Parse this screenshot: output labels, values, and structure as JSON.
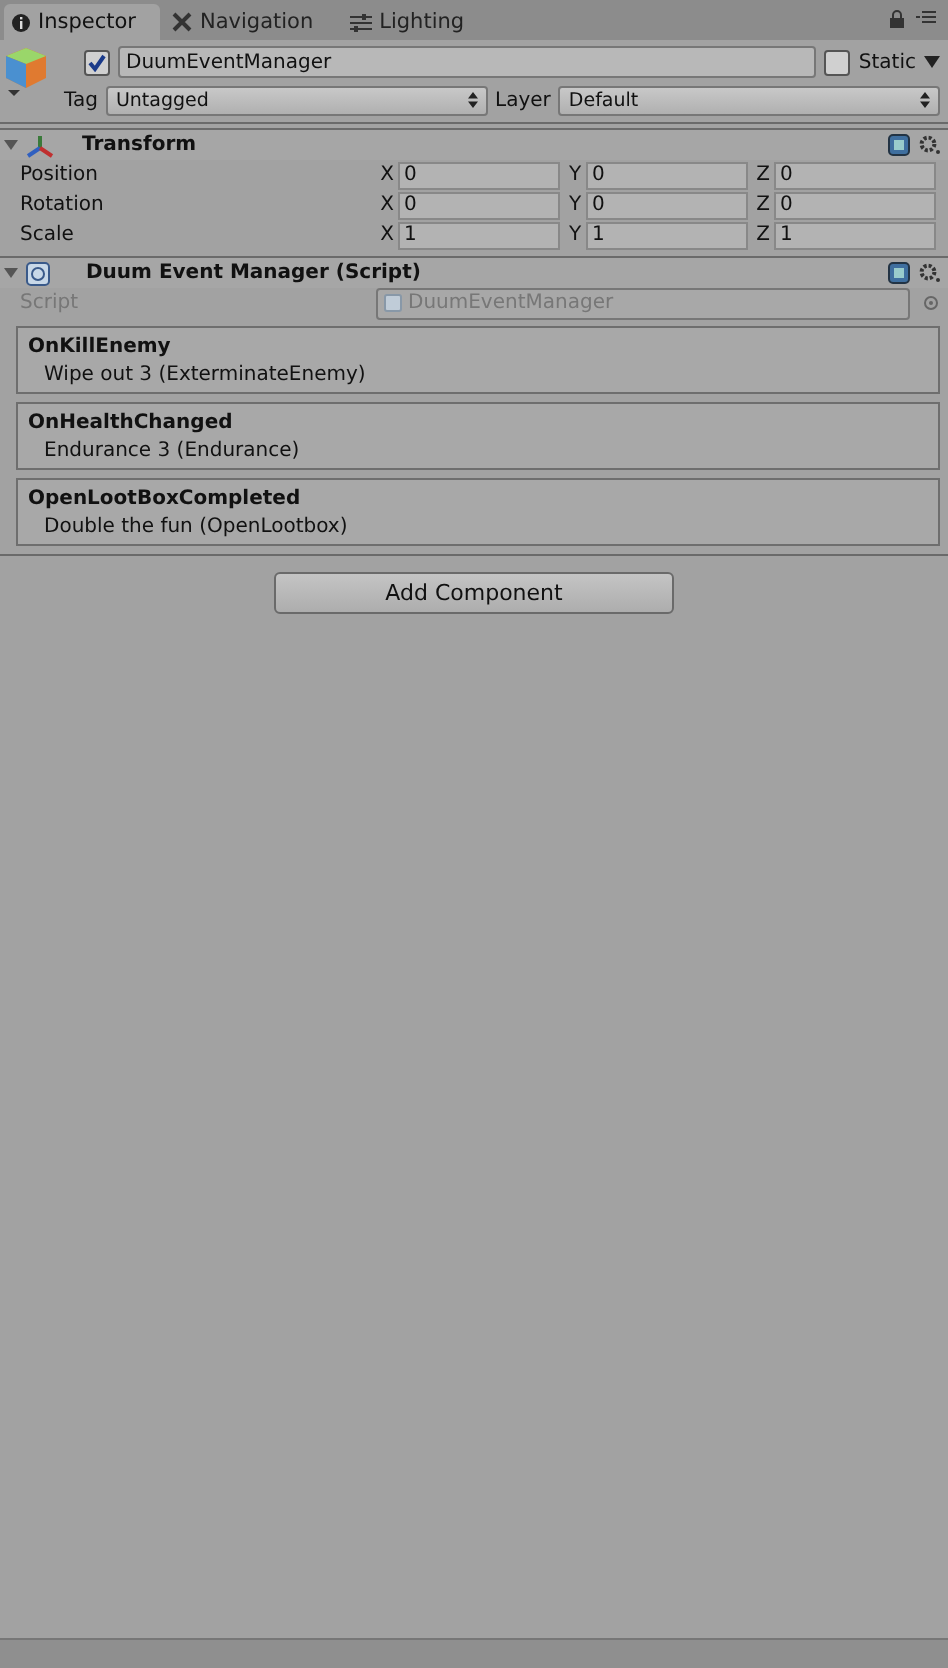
{
  "tabs": [
    {
      "label": "Inspector",
      "kind": "info",
      "selected": true
    },
    {
      "label": "Navigation",
      "kind": "nav",
      "selected": false
    },
    {
      "label": "Lighting",
      "kind": "light",
      "selected": false
    }
  ],
  "game_object": {
    "active": true,
    "name": "DuumEventManager",
    "static": false,
    "static_label": "Static",
    "tag_label": "Tag",
    "tag": "Untagged",
    "layer_label": "Layer",
    "layer": "Default"
  },
  "transform": {
    "title": "Transform",
    "expanded": true,
    "rows": [
      {
        "label": "Position",
        "fields": [
          {
            "axis": "X",
            "value": "0"
          },
          {
            "axis": "Y",
            "value": "0"
          },
          {
            "axis": "Z",
            "value": "0"
          }
        ]
      },
      {
        "label": "Rotation",
        "fields": [
          {
            "axis": "X",
            "value": "0"
          },
          {
            "axis": "Y",
            "value": "0"
          },
          {
            "axis": "Z",
            "value": "0"
          }
        ]
      },
      {
        "label": "Scale",
        "fields": [
          {
            "axis": "X",
            "value": "1"
          },
          {
            "axis": "Y",
            "value": "1"
          },
          {
            "axis": "Z",
            "value": "1"
          }
        ]
      }
    ]
  },
  "script_component": {
    "title": "Duum Event Manager (Script)",
    "expanded": true,
    "field_label": "Script",
    "value": "DuumEventManager",
    "disabled": true,
    "events": [
      {
        "name": "OnKillEnemy",
        "handler": "Wipe out 3 (ExterminateEnemy)"
      },
      {
        "name": "OnHealthChanged",
        "handler": "Endurance 3 (Endurance)"
      },
      {
        "name": "OpenLootBoxCompleted",
        "handler": "Double the fun (OpenLootbox)"
      }
    ]
  },
  "add_component_button": "Add Component"
}
